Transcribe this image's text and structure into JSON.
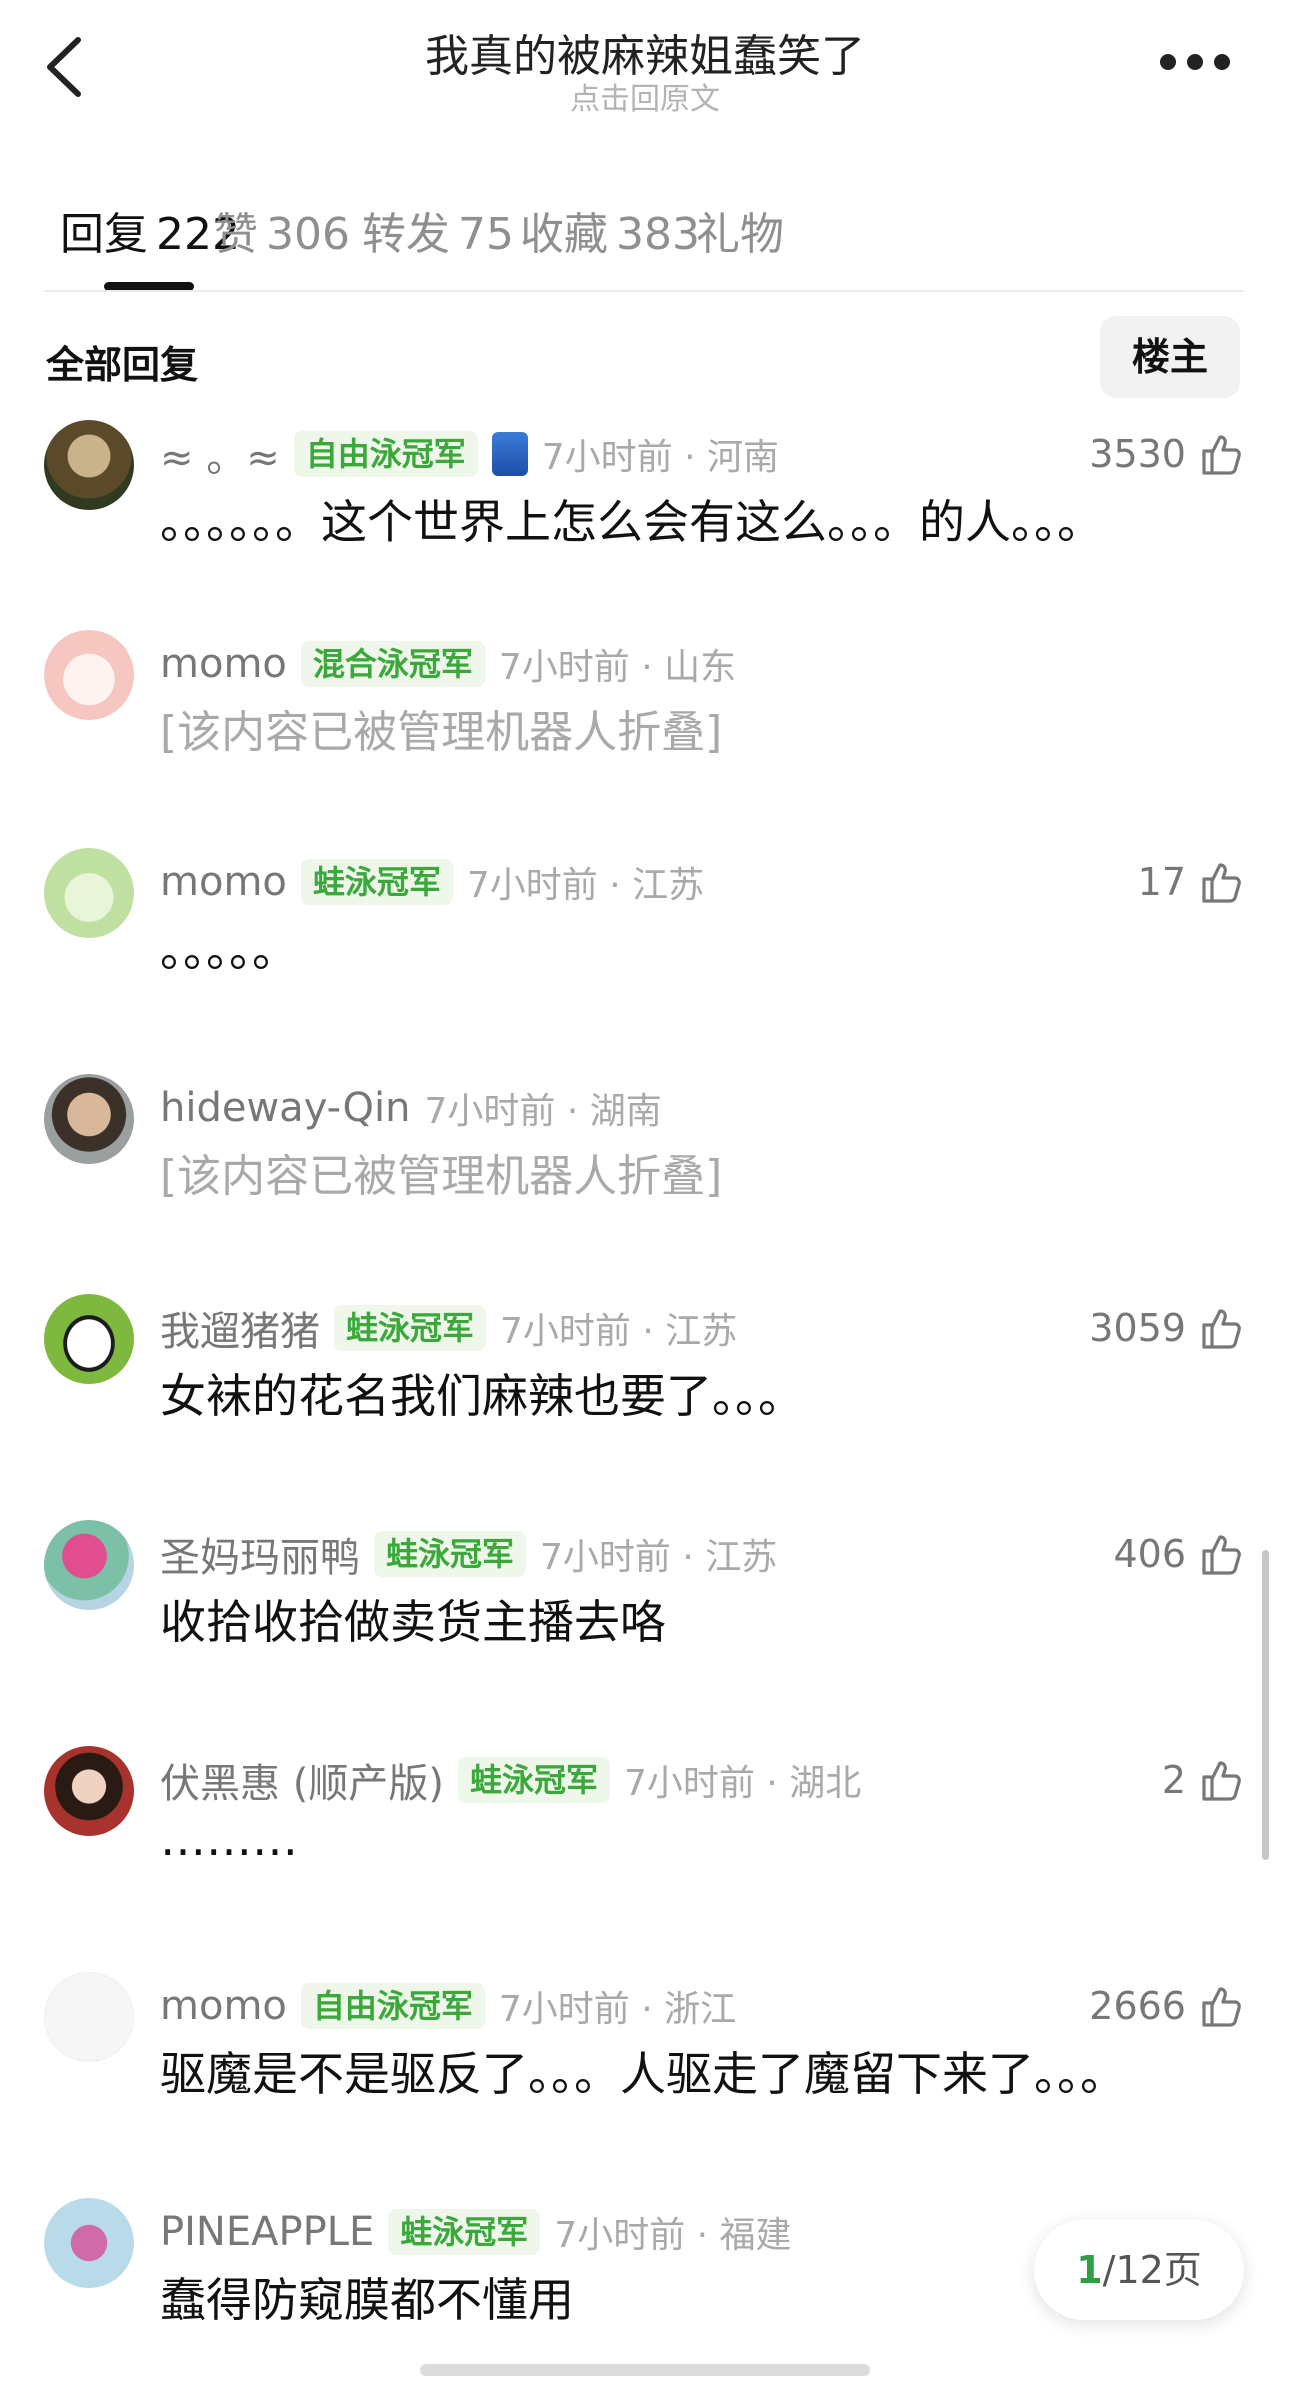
{
  "header": {
    "title": "我真的被麻辣姐蠢笑了",
    "subtitle": "点击回原文"
  },
  "tabs": [
    {
      "label": "回复",
      "count": "222"
    },
    {
      "label": "赞",
      "count": "306"
    },
    {
      "label": "转发",
      "count": "75"
    },
    {
      "label": "收藏",
      "count": "383"
    },
    {
      "label": "礼物",
      "count": ""
    }
  ],
  "section": {
    "title": "全部回复",
    "op_button": "楼主"
  },
  "comments": [
    {
      "name": "≈  。≈",
      "badge": "自由泳冠军",
      "time": "7小时前 · 河南",
      "text": "。。。。。。这个世界上怎么会有这么。。。的人。。。",
      "likes": "3530",
      "avatar_color": "#6b6a3c"
    },
    {
      "name": "momo",
      "badge": "混合泳冠军",
      "time": "7小时前 · 山东",
      "text": "[该内容已被管理机器人折叠]",
      "likes": "",
      "avatar_color": "#f7c9c4"
    },
    {
      "name": "momo",
      "badge": "蛙泳冠军",
      "time": "7小时前 · 江苏",
      "text": "。。。。。",
      "likes": "17",
      "avatar_color": "#cfe8b4"
    },
    {
      "name": "hideway-Qin",
      "badge": "",
      "time": "7小时前 · 湖南",
      "text": "[该内容已被管理机器人折叠]",
      "likes": "",
      "avatar_color": "#8b7a62"
    },
    {
      "name": "我遛猪猪",
      "badge": "蛙泳冠军",
      "time": "7小时前 · 江苏",
      "text": "女袜的花名我们麻辣也要了。。。",
      "likes": "3059",
      "avatar_color": "#8bc34a"
    },
    {
      "name": "圣妈玛丽鸭",
      "badge": "蛙泳冠军",
      "time": "7小时前 · 江苏",
      "text": "收拾收拾做卖货主播去咯",
      "likes": "406",
      "avatar_color": "#c2578f"
    },
    {
      "name": "伏黑惠 (顺产版)",
      "badge": "蛙泳冠军",
      "time": "7小时前 · 湖北",
      "text": "………",
      "likes": "2",
      "avatar_color": "#7a3b2e"
    },
    {
      "name": "momo",
      "badge": "自由泳冠军",
      "time": "7小时前 · 浙江",
      "text": "驱魔是不是驱反了。。。人驱走了魔留下来了。。。",
      "likes": "2666",
      "avatar_color": "#f3f3f3"
    },
    {
      "name": "PINEAPPLE",
      "badge": "蛙泳冠军",
      "time": "7小时前 · 福建",
      "text": "蠢得防窥膜都不懂用",
      "likes": "",
      "avatar_color": "#b7d7e8"
    }
  ],
  "pager": {
    "current": "1",
    "total": "/12页"
  }
}
